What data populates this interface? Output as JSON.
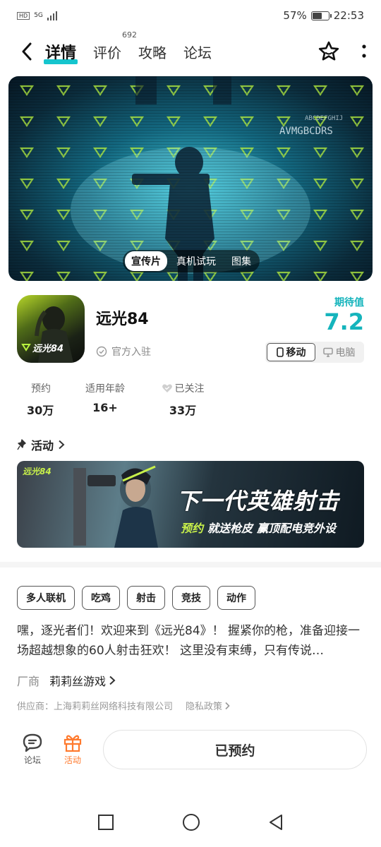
{
  "status_bar": {
    "hd": "HD",
    "network": "5G",
    "battery_text": "57%",
    "battery_level": 0.57,
    "time": "22:53"
  },
  "nav": {
    "tabs": [
      {
        "label": "详情",
        "active": true
      },
      {
        "label": "评价",
        "badge": "692"
      },
      {
        "label": "攻略"
      },
      {
        "label": "论坛"
      }
    ]
  },
  "hero": {
    "media_tabs": [
      {
        "label": "宣传片",
        "active": true
      },
      {
        "label": "真机试玩"
      },
      {
        "label": "图集"
      }
    ]
  },
  "app": {
    "name": "远光84",
    "official": "官方入驻",
    "expect_label": "期待值",
    "expect_score": "7.2",
    "icon_logo": "远光84",
    "platforms": [
      {
        "label": "移动",
        "active": true
      },
      {
        "label": "电脑"
      }
    ]
  },
  "stats": [
    {
      "label": "预约",
      "value": "30万"
    },
    {
      "label": "适用年龄",
      "value": "16+"
    },
    {
      "label": "已关注",
      "value": "33万"
    }
  ],
  "activity": {
    "header": "活动",
    "banner": {
      "logo": "远光84",
      "title": "下一代英雄射击",
      "sub_highlight": "预约",
      "sub_text_1": "就送枪皮",
      "sub_text_2": "赢顶配电竞外设"
    }
  },
  "tags": [
    "多人联机",
    "吃鸡",
    "射击",
    "竞技",
    "动作"
  ],
  "description": "嘿，逐光者们！欢迎来到《远光84》！ 握紧你的枪，准备迎接一场超越想象的60人射击狂欢！ 这里没有束缚，只有传说…",
  "vendor": {
    "label": "厂商",
    "name": "莉莉丝游戏"
  },
  "supplier": {
    "text": "供应商：上海莉莉丝网络科技有限公司",
    "privacy": "隐私政策"
  },
  "bottom_bar": {
    "forum_label": "论坛",
    "activity_label": "活动",
    "reserve_label": "已预约"
  },
  "colors": {
    "accent": "#15c5ce",
    "score": "#15b4bc",
    "activity": "#ff7a2e"
  }
}
